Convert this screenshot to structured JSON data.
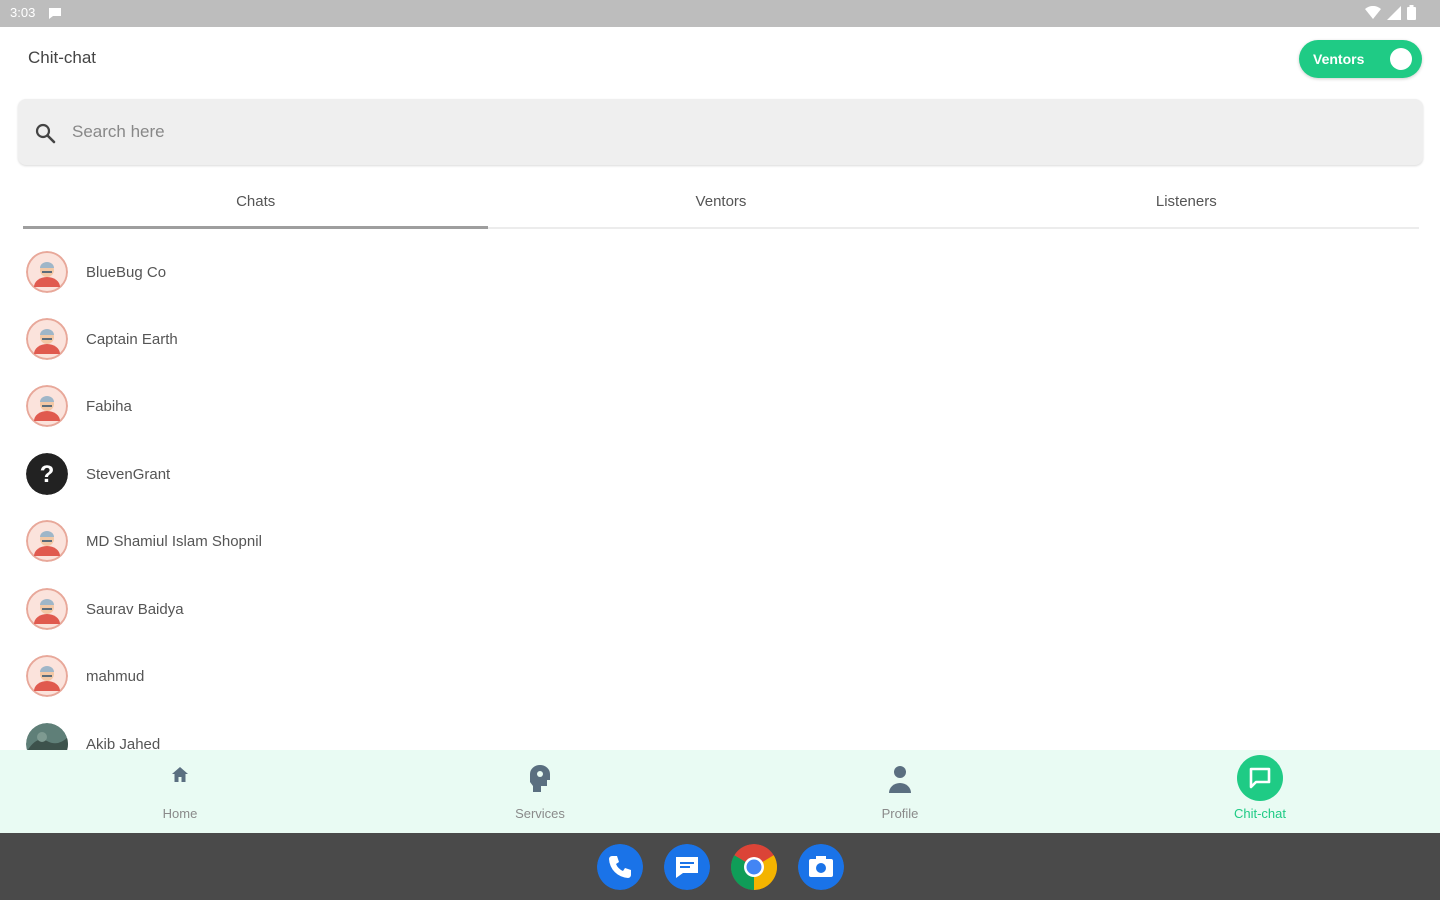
{
  "status_bar": {
    "time": "3:03"
  },
  "app_bar": {
    "title": "Chit-chat",
    "toggle_label": "Ventors"
  },
  "search": {
    "placeholder": "Search here"
  },
  "tabs": [
    {
      "label": "Chats",
      "active": true
    },
    {
      "label": "Ventors",
      "active": false
    },
    {
      "label": "Listeners",
      "active": false
    }
  ],
  "chats": [
    {
      "name": "BlueBug Co",
      "avatar": "default-avatar"
    },
    {
      "name": "Captain Earth",
      "avatar": "default-avatar"
    },
    {
      "name": "Fabiha",
      "avatar": "default-avatar"
    },
    {
      "name": "StevenGrant",
      "avatar": "question-avatar"
    },
    {
      "name": "MD Shamiul Islam Shopnil",
      "avatar": "default-avatar"
    },
    {
      "name": "Saurav Baidya",
      "avatar": "default-avatar"
    },
    {
      "name": "mahmud",
      "avatar": "default-avatar"
    },
    {
      "name": "Akib Jahed",
      "avatar": "photo-avatar"
    }
  ],
  "bottom_nav": [
    {
      "label": "Home",
      "icon": "home-icon",
      "active": false
    },
    {
      "label": "Services",
      "icon": "services-icon",
      "active": false
    },
    {
      "label": "Profile",
      "icon": "person-icon",
      "active": false
    },
    {
      "label": "Chit-chat",
      "icon": "chat-icon",
      "active": true
    }
  ],
  "dock": [
    {
      "app": "Phone",
      "icon": "phone-icon"
    },
    {
      "app": "Messages",
      "icon": "messages-icon"
    },
    {
      "app": "Chrome",
      "icon": "chrome-icon"
    },
    {
      "app": "Camera",
      "icon": "camera-icon"
    }
  ],
  "colors": {
    "accent": "#1fcb85",
    "nav_background": "#e9fbf3",
    "dock_background": "#4a4a4a"
  }
}
